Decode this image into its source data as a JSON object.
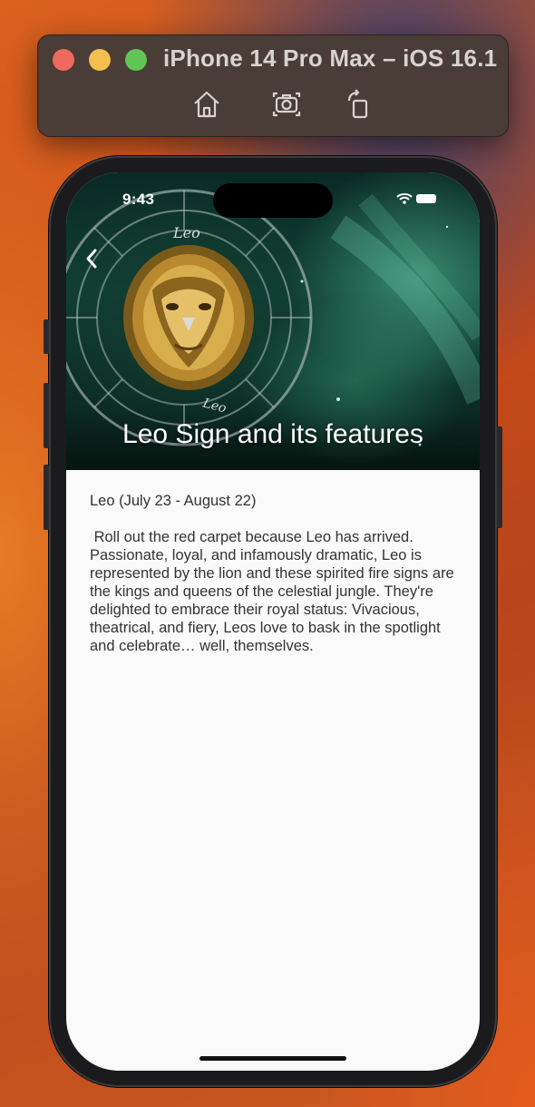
{
  "simulator": {
    "title": "iPhone 14 Pro Max – iOS 16.1",
    "toolbar": {
      "icons": [
        "home-icon",
        "screenshot-icon",
        "rotate-icon"
      ]
    }
  },
  "status_bar": {
    "time": "9:43",
    "icons": [
      "wifi-icon",
      "battery-icon"
    ]
  },
  "hero": {
    "title": "Leo Sign and its features",
    "image_labels": [
      "Leo",
      "Leo"
    ]
  },
  "content": {
    "subtitle": "Leo (July 23 - August 22)",
    "body": " Roll out the red carpet because Leo has arrived. Passionate, loyal, and infamously dramatic, Leo is represented by the lion and these spirited fire signs are the kings and queens of the celestial jungle. They're delighted to embrace their royal status: Vivacious, theatrical, and fiery, Leos love to bask in the spotlight and celebrate… well, themselves."
  },
  "colors": {
    "screen_bg": "#fafafa",
    "text": "#333333",
    "hero_title": "#ffffff"
  }
}
